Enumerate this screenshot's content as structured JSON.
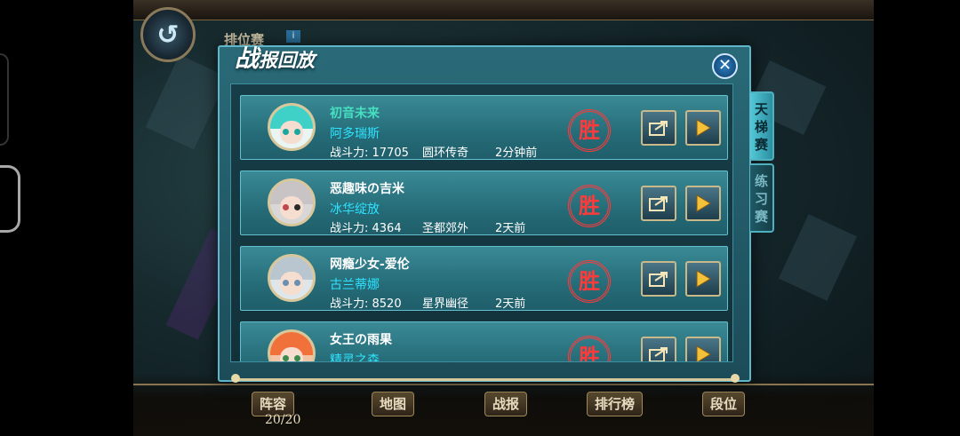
{
  "header": {
    "back_icon": "back-arrow-icon",
    "rank_label": "排位赛"
  },
  "dialog": {
    "title_first": "战",
    "title_rest": "报回放",
    "close_icon": "close-icon"
  },
  "tabs": [
    {
      "label": "天梯赛",
      "active": true
    },
    {
      "label": "练习赛",
      "active": false
    }
  ],
  "battles": [
    {
      "name": "初音未来",
      "name_color": "#46e0c0",
      "guild": "阿多瑞斯",
      "power": "战斗力: 17705",
      "location": "圆环传奇",
      "time": "2分钟前",
      "result": "胜"
    },
    {
      "name": "恶趣味の吉米",
      "name_color": "#ffffff",
      "guild": "冰华绽放",
      "power": "战斗力: 4364",
      "location": "圣都郊外",
      "time": "2天前",
      "result": "胜"
    },
    {
      "name": "网瘾少女-爱伦",
      "name_color": "#ffffff",
      "guild": "古兰蒂娜",
      "power": "战斗力: 8520",
      "location": "星界幽径",
      "time": "2天前",
      "result": "胜"
    },
    {
      "name": "女王の雨果",
      "name_color": "#ffffff",
      "guild": "精灵之森",
      "power": "",
      "location": "",
      "time": "",
      "result": "胜"
    }
  ],
  "bottom_nav": [
    {
      "label": "阵容"
    },
    {
      "label": "地图"
    },
    {
      "label": "战报"
    },
    {
      "label": "排行榜"
    },
    {
      "label": "段位"
    }
  ],
  "roster_count": "20/20",
  "colors": {
    "win": "#ff3a3a",
    "guild": "#2fe3ff",
    "panel": "#256c78"
  }
}
